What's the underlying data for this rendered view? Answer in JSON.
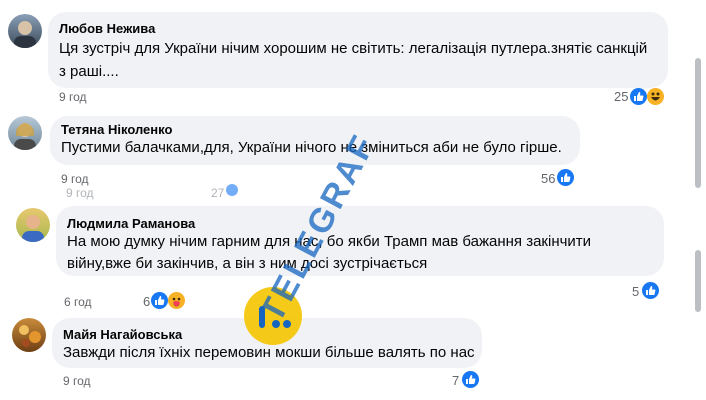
{
  "comments": [
    {
      "author": "Любов Нежива",
      "lines": [
        "Ця зустріч для України нічим хорошим не світить: легалізація путлера.знятіє санкцій",
        "з раші...."
      ],
      "time": "9 год",
      "reactions_count": "25",
      "reactions": [
        "like-icon",
        "haha-icon"
      ]
    },
    {
      "author": "Тетяна Ніколенко",
      "lines": [
        "Пустими балачками,для, України нічого не зміниться аби не було гірше."
      ],
      "time": "9 год",
      "reactions_count": "56",
      "reactions": [
        "like-icon"
      ]
    },
    {
      "author": "Людмила Раманова",
      "lines": [
        "На мою думку нічим гарним для нас, бо якби Трамп мав бажання закінчити",
        "війну,вже би закінчив, а він з ним досі зустрічається"
      ],
      "time": "6 год",
      "reactions_count": "6",
      "reactions": [
        "like-icon",
        "care-icon"
      ]
    },
    {
      "author": "Майя Нагайовська",
      "lines": [
        "Завжди після їхніх перемовин мокши більше валять по нас"
      ],
      "time": "9 год",
      "reactions_count": "7",
      "reactions": [
        "like-icon"
      ]
    }
  ],
  "ghost": {
    "left_time": "9 год",
    "left_count": "27",
    "right_count": "5"
  },
  "watermark": "TELEGRAF",
  "colors": {
    "bubble": "#f0f2f5",
    "like": "#1877f2",
    "meta": "#65676b",
    "watermark": "#1565c0",
    "logo": "#f5c400"
  }
}
